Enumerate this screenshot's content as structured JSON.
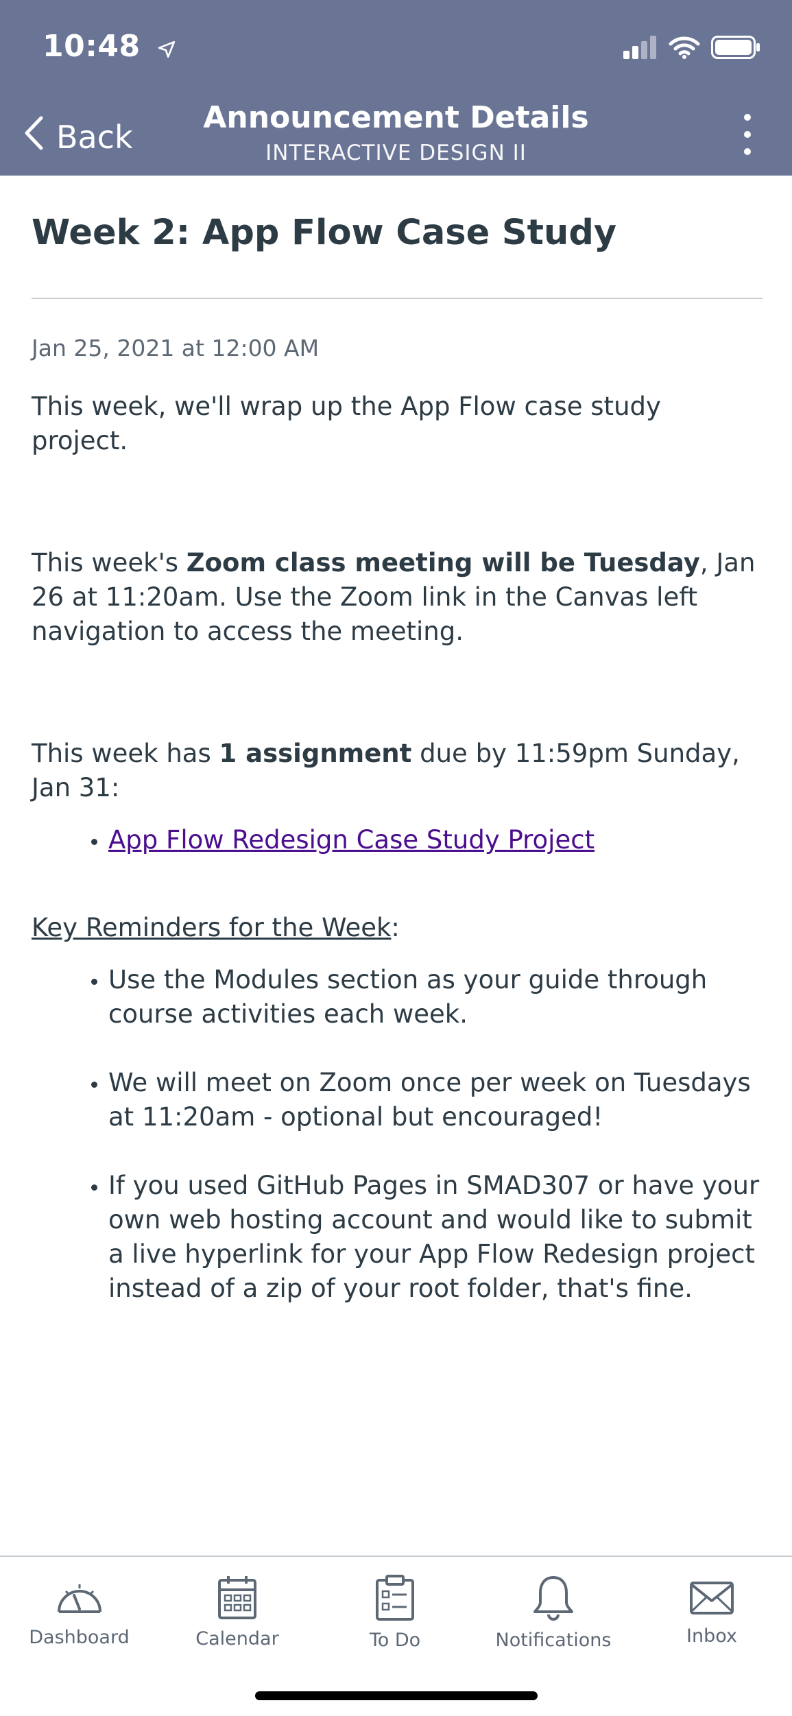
{
  "status_bar": {
    "time": "10:48"
  },
  "header": {
    "back_label": "Back",
    "title": "Announcement Details",
    "subtitle": "INTERACTIVE DESIGN II",
    "header_color": "#6a7596"
  },
  "announcement": {
    "title": "Week 2: App Flow Case Study",
    "date": "Jan 25, 2021 at 12:00 AM",
    "para1": "This week, we'll wrap up the App Flow case study project.",
    "para2_a": "This week's ",
    "para2_b": "Zoom class meeting will be Tuesday",
    "para2_c": ", Jan 26 at 11:20am. Use the Zoom link in the Canvas left navigation to access the meeting.",
    "para3_a": "This week has ",
    "para3_b": "1 assignment",
    "para3_c": " due by 11:59pm Sunday, Jan 31:",
    "assignment_link": "App Flow Redesign Case Study Project",
    "reminders_heading": "Key Reminders for the Week",
    "reminders_colon": ":",
    "reminders": [
      "Use the Modules section as your guide through course activities each week.",
      "We will meet on Zoom once per week on Tuesdays at 11:20am - optional but encouraged!",
      "If you used GitHub Pages in SMAD307 or have your own web hosting account and would like to submit a live hyperlink for your App Flow Redesign project instead of a zip of your root folder, that's fine."
    ]
  },
  "tabbar": {
    "tabs": [
      {
        "label": "Dashboard",
        "icon": "dashboard-icon"
      },
      {
        "label": "Calendar",
        "icon": "calendar-icon"
      },
      {
        "label": "To Do",
        "icon": "todo-icon"
      },
      {
        "label": "Notifications",
        "icon": "bell-icon"
      },
      {
        "label": "Inbox",
        "icon": "envelope-icon"
      }
    ]
  }
}
